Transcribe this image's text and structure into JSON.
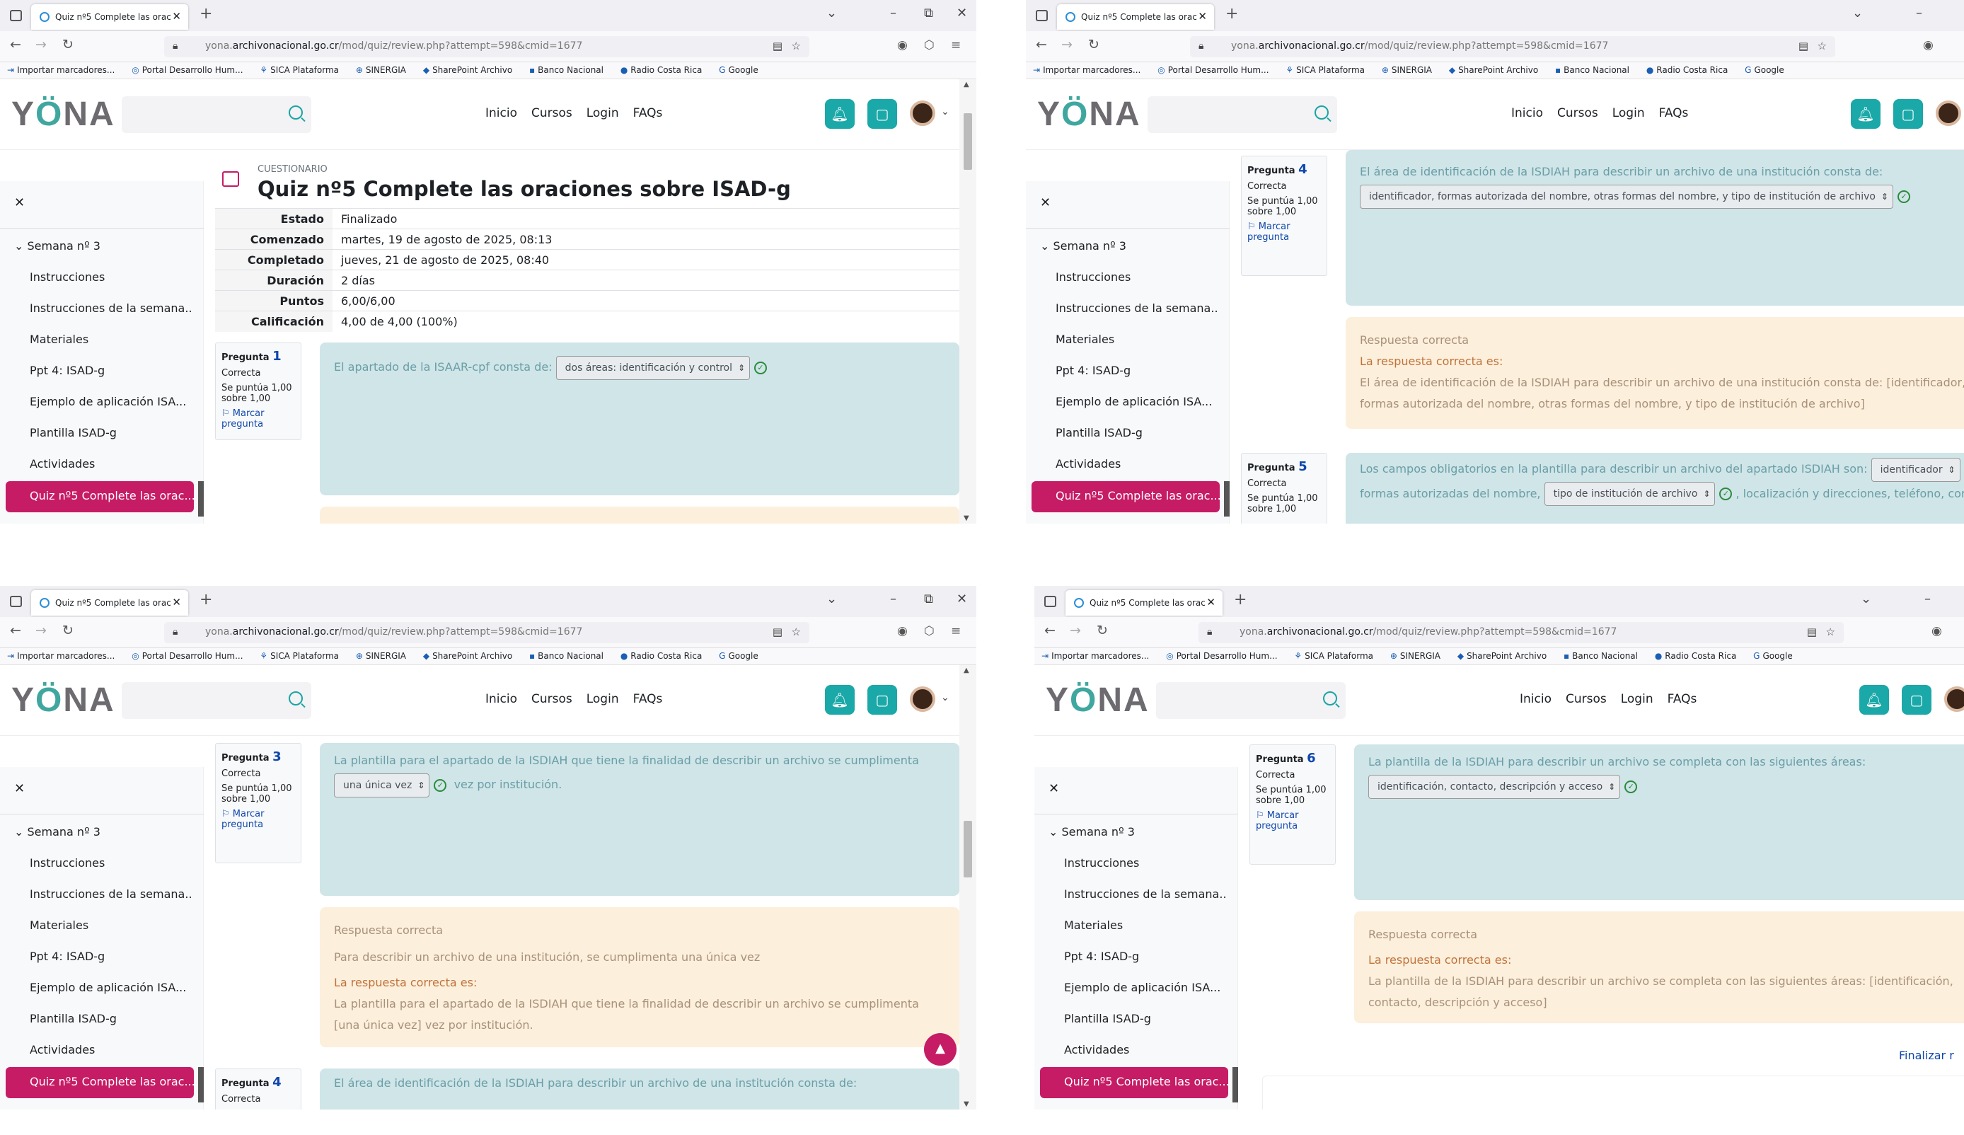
{
  "browser": {
    "tab_title": "Quiz nº5 Complete las oraciones sobre ISAD-g",
    "url_prefix": "yona.",
    "url_domain": "archivonacional.go.cr",
    "url_path": "/mod/quiz/review.php?attempt=598&cmid=1677",
    "bookmarks": [
      "Importar marcadores...",
      "Portal Desarrollo Hum...",
      "SICA Plataforma",
      "SINERGIA",
      "SharePoint Archivo",
      "Banco Nacional",
      "Radio Costa Rica",
      "Google"
    ]
  },
  "header": {
    "logo_a": "Y",
    "logo_b": "Ö",
    "logo_c": "NA",
    "nav": [
      "Inicio",
      "Cursos",
      "Login",
      "FAQs"
    ]
  },
  "drawer": {
    "week": "Semana nº 3",
    "items": [
      "Instrucciones",
      "Instrucciones de la semana...",
      "Materiales",
      "Ppt 4: ISAD-g",
      "Ejemplo de aplicación ISA...",
      "Plantilla ISAD-g",
      "Actividades"
    ],
    "active": "Quiz nº5 Complete las orac..."
  },
  "quiz": {
    "caption": "CUESTIONARIO",
    "title": "Quiz nº5 Complete las oraciones sobre ISAD-g",
    "summary": [
      {
        "label": "Estado",
        "value": "Finalizado"
      },
      {
        "label": "Comenzado",
        "value": "martes, 19 de agosto de 2025, 08:13"
      },
      {
        "label": "Completado",
        "value": "jueves, 21 de agosto de 2025, 08:40"
      },
      {
        "label": "Duración",
        "value": "2 días"
      },
      {
        "label": "Puntos",
        "value": "6,00/6,00"
      },
      {
        "label": "Calificación",
        "value": "4,00 de 4,00 (100%)"
      }
    ]
  },
  "labels": {
    "pregunta": "Pregunta",
    "correcta": "Correcta",
    "score": "Se puntúa 1,00 sobre 1,00",
    "flag": "Marcar pregunta",
    "respuesta_correcta": "Respuesta correcta",
    "la_respuesta_correcta": "La respuesta correcta es:",
    "finalizar": "Finalizar r"
  },
  "questions": {
    "q1": {
      "num": "1",
      "text": "El apartado de la ISAAR-cpf consta de:",
      "answer": "dos áreas: identificación y control"
    },
    "q3": {
      "num": "3",
      "text_a": "La plantilla para el apartado de la ISDIAH que tiene la finalidad de describir un archivo se cumplimenta",
      "answer": "una única vez",
      "text_b": "vez por institución.",
      "feedback": "Para describir un archivo de una institución, se cumplimenta una única vez",
      "correct": "La plantilla para el apartado de la ISDIAH que tiene la finalidad de describir un archivo se cumplimenta [una única vez] vez por institución."
    },
    "q4": {
      "num": "4",
      "text": "El área de identificación de la ISDIAH para describir un archivo de una institución consta de:",
      "answer": "identificador, formas autorizada del nombre, otras formas del nombre, y tipo de institución de archivo",
      "correct": "El área de identificación de la ISDIAH para describir un archivo de una institución consta de: [identificador, formas autorizada del nombre, otras formas del nombre, y tipo de institución de archivo]"
    },
    "q5": {
      "num": "5",
      "text_a": "Los campos obligatorios en la plantilla para describir un archivo del apartado ISDIAH son:",
      "answer_a": "identificador",
      "text_b": "formas autorizadas del nombre,",
      "answer_b": "tipo de institución de archivo",
      "text_c": ", localización y direcciones, teléfono, corre"
    },
    "q6": {
      "num": "6",
      "text": "La plantilla de la ISDIAH para describir un archivo se completa con las siguientes áreas:",
      "answer": "identificación, contacto, descripción y acceso",
      "correct": "La plantilla de la ISDIAH para describir un archivo se completa con las siguientes áreas: [identificación, contacto, descripción y acceso]"
    }
  },
  "colors": {
    "accent": "#c51c65",
    "teal": "#1ba8a8",
    "question_bg": "#cfe5e8",
    "feedback_bg": "#fcefdc"
  },
  "icons": [
    "bell-icon",
    "chat-icon",
    "search-icon",
    "check-icon",
    "flag-icon",
    "arrow-up-icon"
  ]
}
